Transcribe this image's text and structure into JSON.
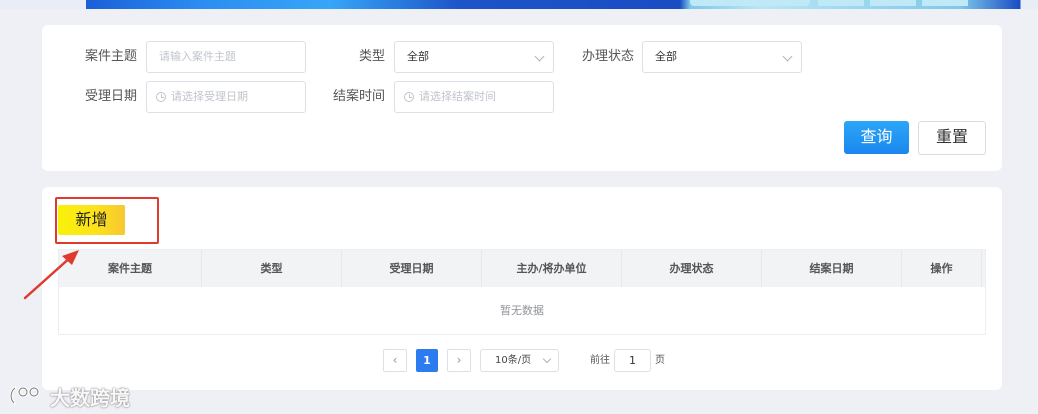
{
  "search": {
    "subject_label": "案件主题",
    "subject_placeholder": "请输入案件主题",
    "type_label": "类型",
    "type_value": "全部",
    "status_label": "办理状态",
    "status_value": "全部",
    "accept_date_label": "受理日期",
    "accept_date_placeholder": "请选择受理日期",
    "close_time_label": "结案时间",
    "close_time_placeholder": "请选择结案时间",
    "query_button": "查询",
    "reset_button": "重置"
  },
  "toolbar": {
    "add_button": "新增"
  },
  "table": {
    "columns": [
      "案件主题",
      "类型",
      "受理日期",
      "主办/将办单位",
      "办理状态",
      "结案日期",
      "操作"
    ],
    "empty_text": "暂无数据"
  },
  "pagination": {
    "current_page": "1",
    "page_size": "10条/页",
    "goto_prefix": "前往",
    "goto_value": "1",
    "goto_suffix": "页",
    "prev_icon": "chevron-left-icon",
    "next_icon": "chevron-right-icon"
  },
  "annotation": {
    "highlight_color": "#e03a2c"
  },
  "watermark": {
    "text": "大数跨境",
    "logo_icon": "brand-logo-icon"
  },
  "colors": {
    "primary": "#1a87ef",
    "add_button": "#fde21a",
    "page_active": "#2c7cf0"
  }
}
